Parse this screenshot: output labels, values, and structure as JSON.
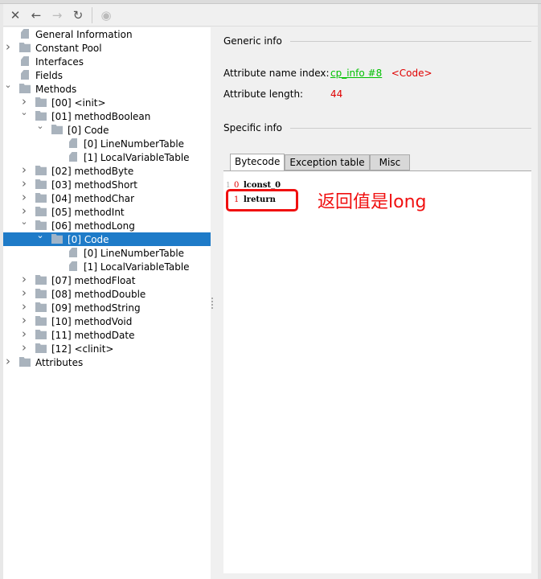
{
  "toolbar": {
    "items": [
      {
        "name": "close-icon",
        "glyph": "✕",
        "enabled": true
      },
      {
        "name": "back-arrow-icon",
        "glyph": "←",
        "enabled": true
      },
      {
        "name": "forward-arrow-icon",
        "glyph": "→",
        "enabled": false
      },
      {
        "name": "refresh-icon",
        "glyph": "↻",
        "enabled": true
      },
      {
        "name": "web-globe-icon",
        "glyph": "◉",
        "enabled": false
      }
    ]
  },
  "tree": [
    {
      "label": "General Information",
      "level": 0,
      "type": "file"
    },
    {
      "label": "Constant Pool",
      "level": 0,
      "type": "folder",
      "expander": "collapsed"
    },
    {
      "label": "Interfaces",
      "level": 0,
      "type": "file"
    },
    {
      "label": "Fields",
      "level": 0,
      "type": "file"
    },
    {
      "label": "Methods",
      "level": 0,
      "type": "folder",
      "expander": "expanded"
    },
    {
      "label": "[00] <init>",
      "level": 1,
      "type": "folder",
      "expander": "collapsed"
    },
    {
      "label": "[01] methodBoolean",
      "level": 1,
      "type": "folder",
      "expander": "expanded"
    },
    {
      "label": "[0] Code",
      "level": 2,
      "type": "folder",
      "expander": "expanded"
    },
    {
      "label": "[0] LineNumberTable",
      "level": 3,
      "type": "file"
    },
    {
      "label": "[1] LocalVariableTable",
      "level": 3,
      "type": "file"
    },
    {
      "label": "[02] methodByte",
      "level": 1,
      "type": "folder",
      "expander": "collapsed"
    },
    {
      "label": "[03] methodShort",
      "level": 1,
      "type": "folder",
      "expander": "collapsed"
    },
    {
      "label": "[04] methodChar",
      "level": 1,
      "type": "folder",
      "expander": "collapsed"
    },
    {
      "label": "[05] methodInt",
      "level": 1,
      "type": "folder",
      "expander": "collapsed"
    },
    {
      "label": "[06] methodLong",
      "level": 1,
      "type": "folder",
      "expander": "expanded"
    },
    {
      "label": "[0] Code",
      "level": 2,
      "type": "folder",
      "expander": "expanded",
      "selected": true
    },
    {
      "label": "[0] LineNumberTable",
      "level": 3,
      "type": "file"
    },
    {
      "label": "[1] LocalVariableTable",
      "level": 3,
      "type": "file"
    },
    {
      "label": "[07] methodFloat",
      "level": 1,
      "type": "folder",
      "expander": "collapsed"
    },
    {
      "label": "[08] methodDouble",
      "level": 1,
      "type": "folder",
      "expander": "collapsed"
    },
    {
      "label": "[09] methodString",
      "level": 1,
      "type": "folder",
      "expander": "collapsed"
    },
    {
      "label": "[10] methodVoid",
      "level": 1,
      "type": "folder",
      "expander": "collapsed"
    },
    {
      "label": "[11] methodDate",
      "level": 1,
      "type": "folder",
      "expander": "collapsed"
    },
    {
      "label": "[12] <clinit>",
      "level": 1,
      "type": "folder",
      "expander": "collapsed"
    },
    {
      "label": "Attributes",
      "level": 0,
      "type": "folder",
      "expander": "collapsed"
    }
  ],
  "detail": {
    "generic_title": "Generic info",
    "name_index_label": "Attribute name index:",
    "name_index_link": "cp_info #8",
    "name_index_value": "<Code>",
    "length_label": "Attribute length:",
    "length_value": "44",
    "specific_title": "Specific info",
    "tabs": [
      "Bytecode",
      "Exception table",
      "Misc"
    ],
    "active_tab": "Bytecode",
    "bytecode": [
      {
        "line": "1",
        "offset": "0",
        "instr": "lconst_0"
      },
      {
        "line": "2",
        "offset": "1",
        "instr": "lreturn"
      }
    ],
    "annotation": "返回值是long"
  },
  "colors": {
    "selection": "#1e7bc8",
    "link": "#00c000",
    "value": "#e00000",
    "annotation": "#f01010"
  }
}
